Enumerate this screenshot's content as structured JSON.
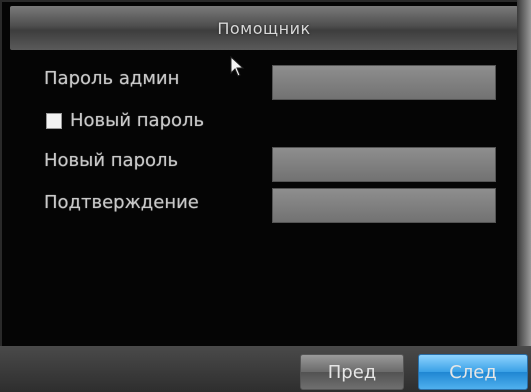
{
  "dialog": {
    "title": "Помощник"
  },
  "form": {
    "admin_password_label": "Пароль админ",
    "new_password_checkbox_label": "Новый пароль",
    "new_password_checked": false,
    "new_password_label": "Новый пароль",
    "confirm_label": "Подтверждение",
    "admin_password_value": "",
    "new_password_value": "",
    "confirm_value": ""
  },
  "buttons": {
    "prev_label": "Пред",
    "next_label": "След"
  },
  "colors": {
    "title_gradient": "#5a5a5a",
    "field_bg": "#7f7f7f",
    "next_button": "#3aa0e6"
  },
  "icons": {
    "cursor": "mouse-pointer-icon"
  }
}
